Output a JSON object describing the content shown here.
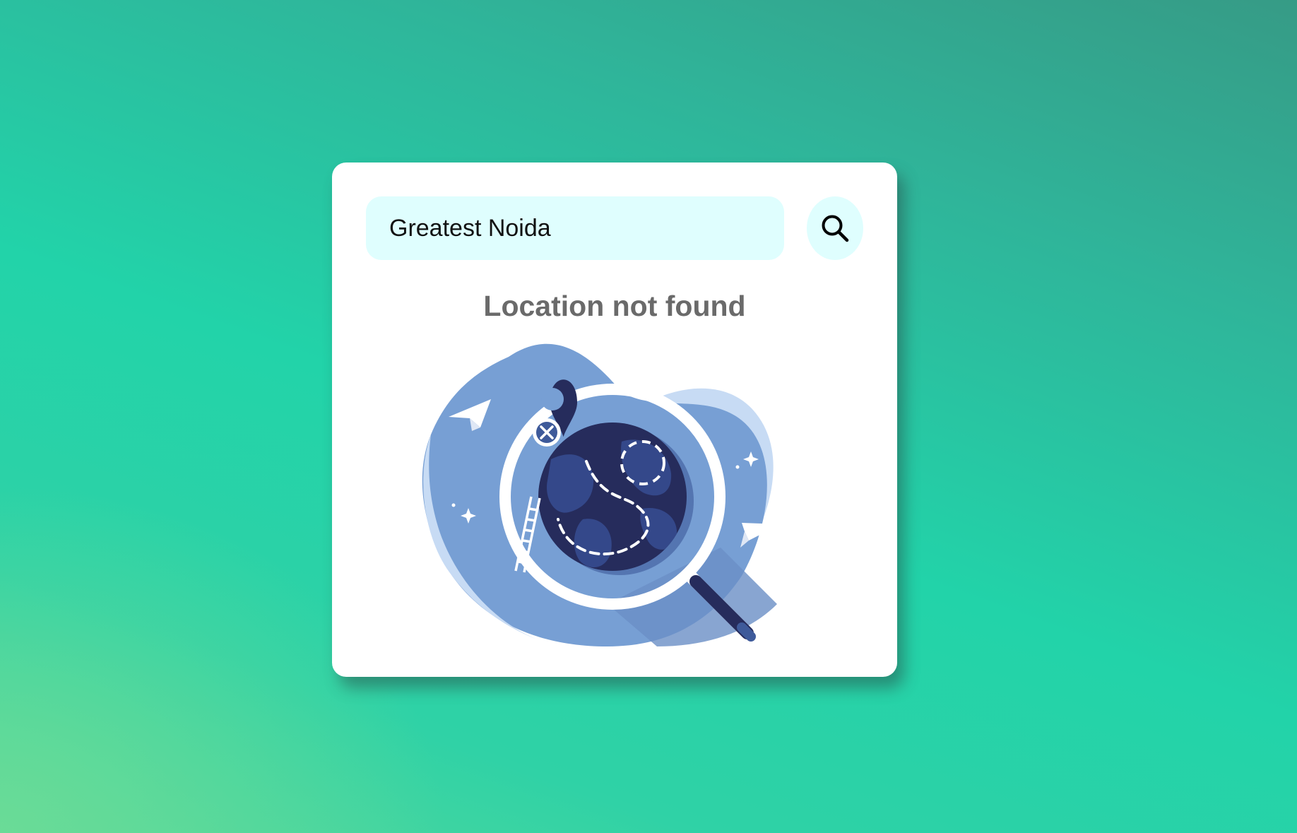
{
  "search": {
    "value": "Greatest Noida",
    "button_icon": "search-icon"
  },
  "status": {
    "message": "Location not found"
  },
  "illustration": {
    "icon": "location-not-found-illustration"
  },
  "colors": {
    "input_background": "#dffefe",
    "status_text": "#6a6a6a",
    "blob": "#779fd4",
    "globe": "#262c5c"
  }
}
